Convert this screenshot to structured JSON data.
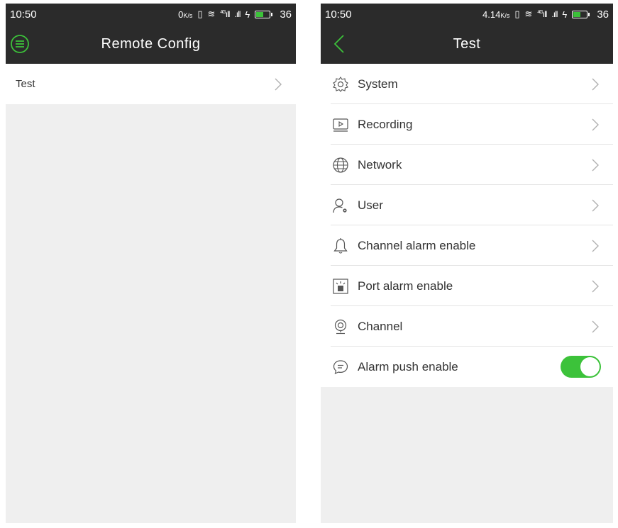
{
  "left": {
    "status": {
      "time": "10:50",
      "speed": "0",
      "speed_unit": "K/s",
      "network": "4G",
      "battery": "36"
    },
    "header": {
      "title": "Remote Config",
      "menu_icon": "menu-circle-icon"
    },
    "items": [
      {
        "label": "Test"
      }
    ]
  },
  "right": {
    "status": {
      "time": "10:50",
      "speed": "4.14",
      "speed_unit": "K/s",
      "network": "4G",
      "battery": "36"
    },
    "header": {
      "title": "Test",
      "back_icon": "back-chevron-icon"
    },
    "items": [
      {
        "label": "System",
        "icon": "gear-icon"
      },
      {
        "label": "Recording",
        "icon": "recording-icon"
      },
      {
        "label": "Network",
        "icon": "globe-icon"
      },
      {
        "label": "User",
        "icon": "user-settings-icon"
      },
      {
        "label": "Channel alarm enable",
        "icon": "bell-icon"
      },
      {
        "label": "Port alarm enable",
        "icon": "alarm-light-icon"
      },
      {
        "label": "Channel",
        "icon": "camera-icon"
      },
      {
        "label": "Alarm push enable",
        "icon": "message-icon",
        "toggle_on": true
      }
    ]
  },
  "colors": {
    "accent": "#3cc23a",
    "header_bg": "#2b2b2b",
    "page_bg": "#efefef"
  }
}
